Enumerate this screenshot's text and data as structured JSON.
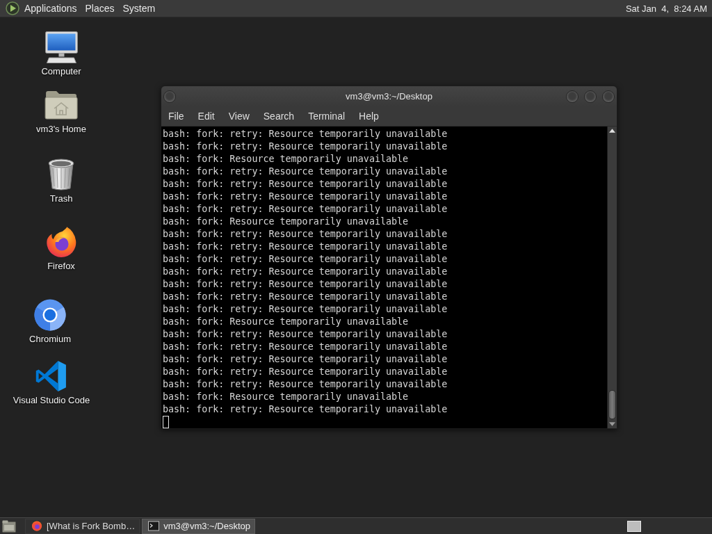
{
  "top_panel": {
    "menus": [
      "Applications",
      "Places",
      "System"
    ],
    "clock": "Sat Jan  4,  8:24 AM"
  },
  "desktop_icons": [
    {
      "label": "Computer",
      "kind": "computer"
    },
    {
      "label": "vm3's Home",
      "kind": "home"
    },
    {
      "label": "Trash",
      "kind": "trash"
    },
    {
      "label": "Firefox",
      "kind": "firefox"
    },
    {
      "label": "Chromium",
      "kind": "chromium"
    },
    {
      "label": "Visual Studio Code",
      "kind": "vscode"
    }
  ],
  "terminal": {
    "title": "vm3@vm3:~/Desktop",
    "menus": [
      "File",
      "Edit",
      "View",
      "Search",
      "Terminal",
      "Help"
    ],
    "lines": [
      "bash: fork: retry: Resource temporarily unavailable",
      "bash: fork: retry: Resource temporarily unavailable",
      "bash: fork: Resource temporarily unavailable",
      "bash: fork: retry: Resource temporarily unavailable",
      "bash: fork: retry: Resource temporarily unavailable",
      "bash: fork: retry: Resource temporarily unavailable",
      "bash: fork: retry: Resource temporarily unavailable",
      "bash: fork: Resource temporarily unavailable",
      "bash: fork: retry: Resource temporarily unavailable",
      "bash: fork: retry: Resource temporarily unavailable",
      "bash: fork: retry: Resource temporarily unavailable",
      "bash: fork: retry: Resource temporarily unavailable",
      "bash: fork: retry: Resource temporarily unavailable",
      "bash: fork: retry: Resource temporarily unavailable",
      "bash: fork: retry: Resource temporarily unavailable",
      "bash: fork: Resource temporarily unavailable",
      "bash: fork: retry: Resource temporarily unavailable",
      "bash: fork: retry: Resource temporarily unavailable",
      "bash: fork: retry: Resource temporarily unavailable",
      "bash: fork: retry: Resource temporarily unavailable",
      "bash: fork: retry: Resource temporarily unavailable",
      "bash: fork: Resource temporarily unavailable",
      "bash: fork: retry: Resource temporarily unavailable"
    ]
  },
  "taskbar": {
    "items": [
      {
        "label": "[What is Fork Bomb…",
        "kind": "browser",
        "selected": false
      },
      {
        "label": "vm3@vm3:~/Desktop",
        "kind": "terminal",
        "selected": true
      }
    ]
  }
}
